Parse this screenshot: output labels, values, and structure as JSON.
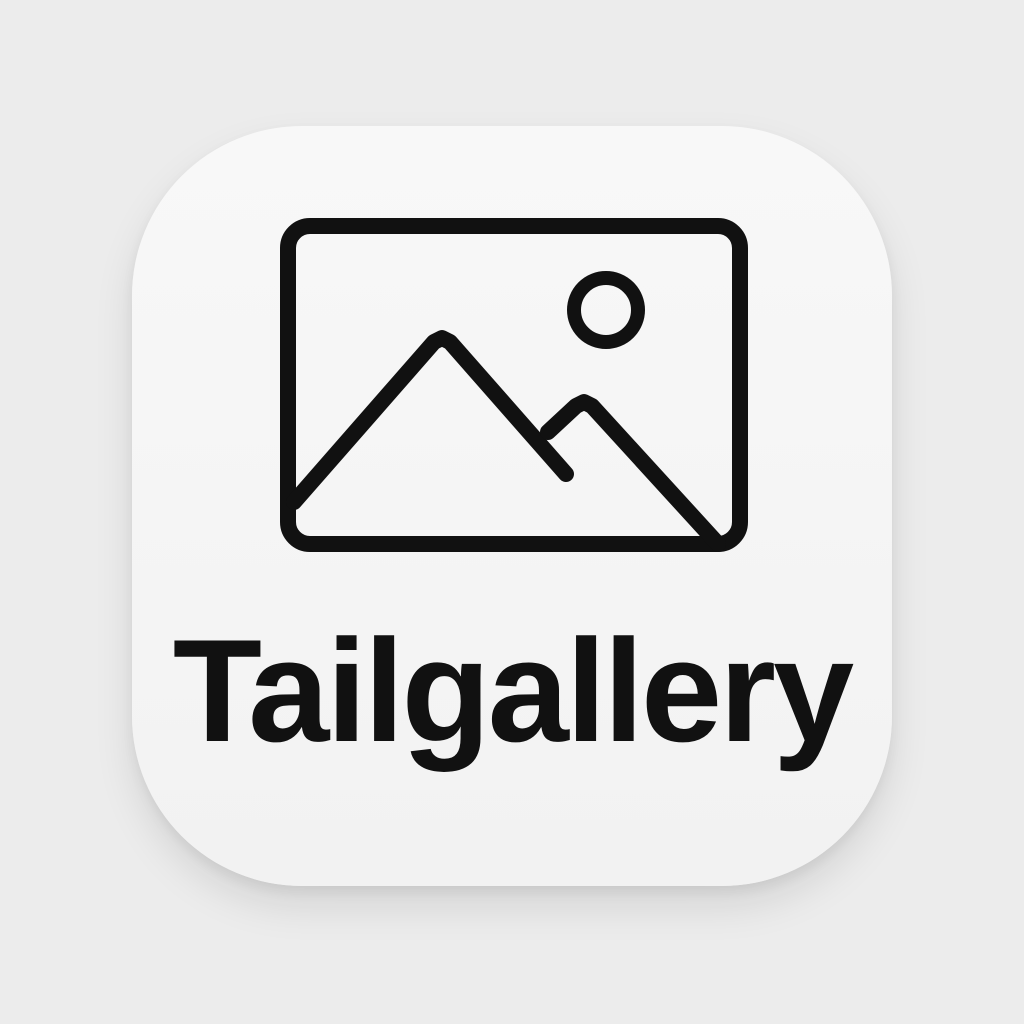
{
  "app": {
    "name": "Tailgallery",
    "icon": "image-icon"
  },
  "colors": {
    "background": "#ececec",
    "tile": "#f4f4f4",
    "ink": "#111111"
  }
}
